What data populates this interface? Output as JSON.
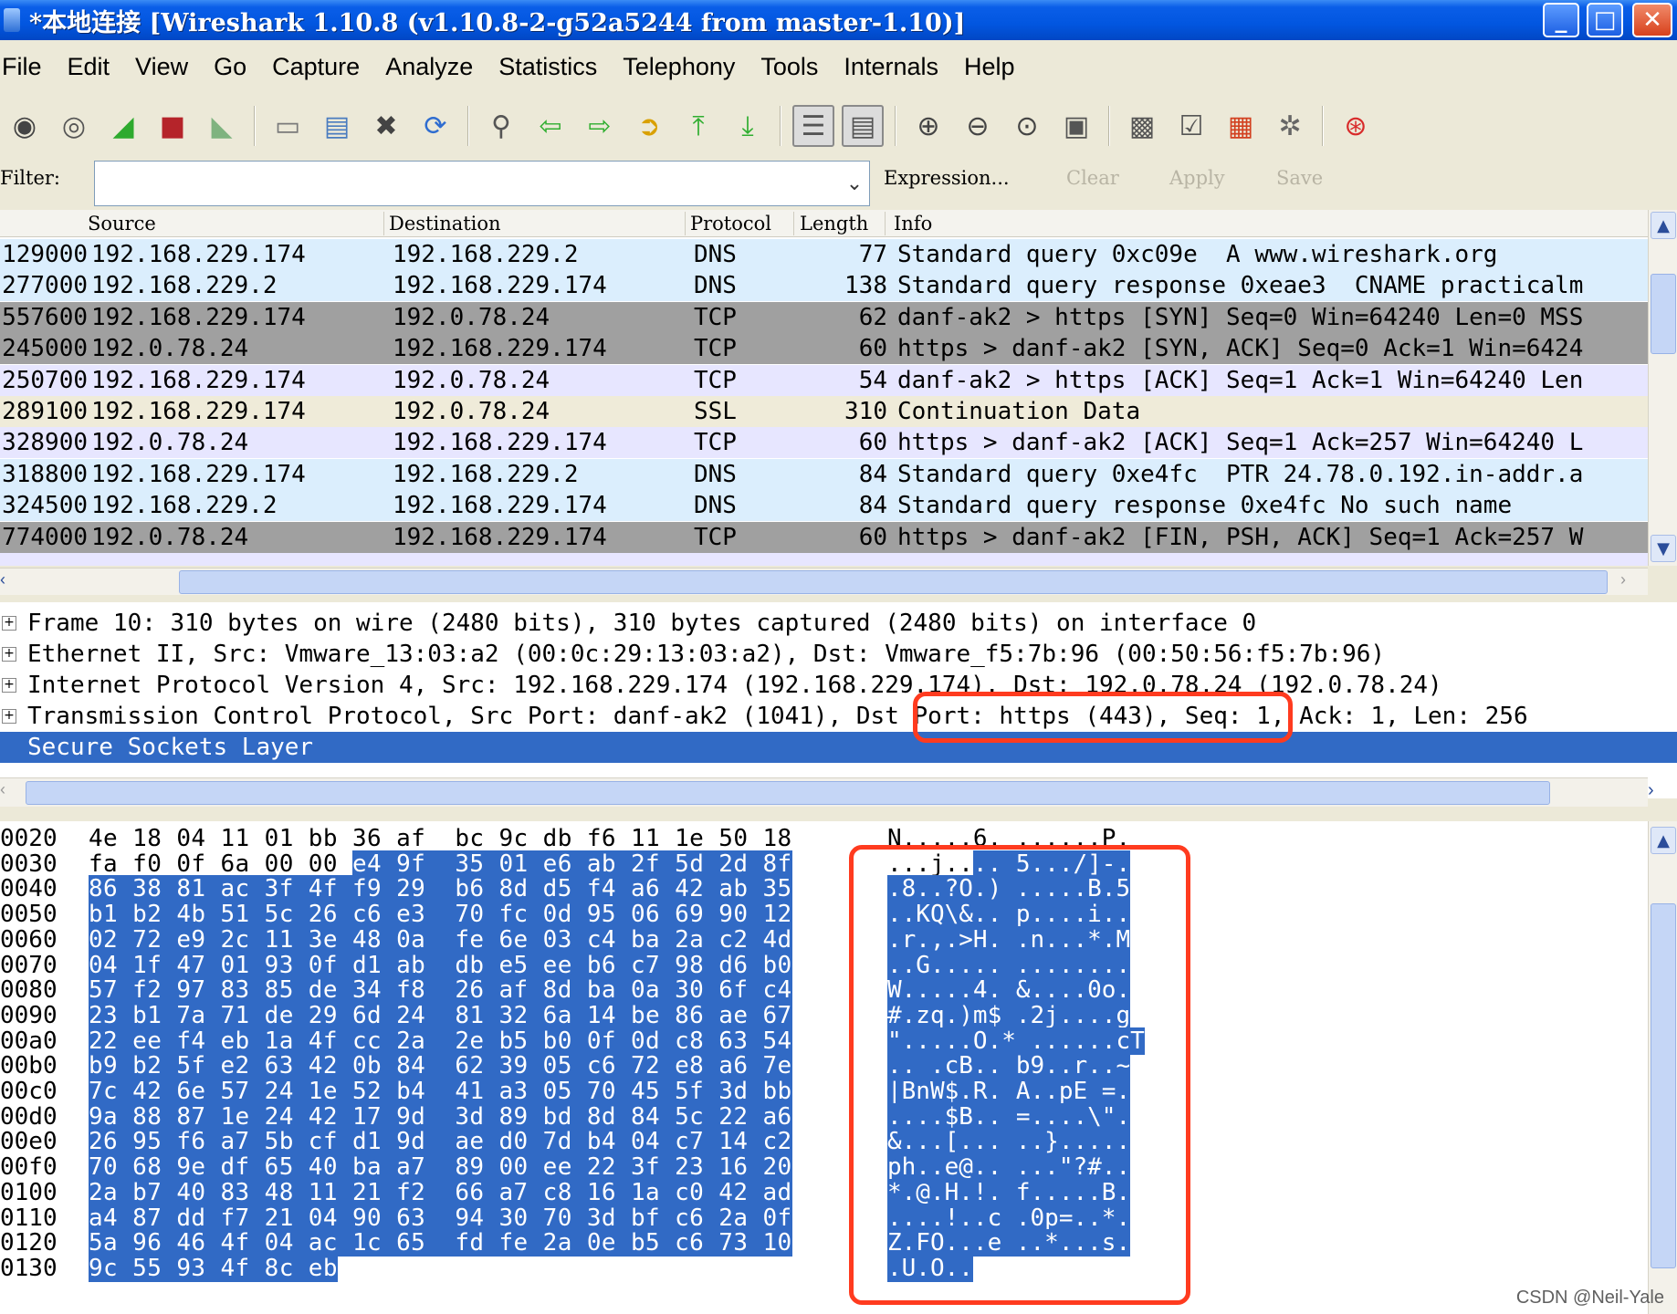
{
  "window": {
    "title": "*本地连接    [Wireshark 1.10.8  (v1.10.8-2-g52a5244 from master-1.10)]",
    "controls": [
      "minimize",
      "maximize",
      "close"
    ]
  },
  "menu": [
    "File",
    "Edit",
    "View",
    "Go",
    "Capture",
    "Analyze",
    "Statistics",
    "Telephony",
    "Tools",
    "Internals",
    "Help"
  ],
  "toolbar": {
    "icons": [
      "interface-list-icon",
      "capture-options-icon",
      "start-capture-icon",
      "stop-capture-icon",
      "restart-capture-icon",
      "open-file-icon",
      "save-file-icon",
      "close-file-icon",
      "reload-icon",
      "find-packet-icon",
      "go-back-icon",
      "go-forward-icon",
      "go-to-packet-icon",
      "go-first-icon",
      "go-last-icon",
      "colorize-icon",
      "autoscroll-icon",
      "zoom-in-icon",
      "zoom-out-icon",
      "normal-size-icon",
      "resize-columns-icon",
      "capture-filters-icon",
      "display-filters-icon",
      "coloring-rules-icon",
      "preferences-icon",
      "help-icon"
    ]
  },
  "filter": {
    "label": "Filter:",
    "value": "",
    "expression": "Expression...",
    "clear": "Clear",
    "apply": "Apply",
    "save": "Save"
  },
  "packet_list": {
    "columns": [
      "Source",
      "Destination",
      "Protocol",
      "Length",
      "Info"
    ],
    "rows": [
      {
        "no": "129000",
        "src": "192.168.229.174",
        "dst": "192.168.229.2",
        "proto": "DNS",
        "len": "77",
        "info": "Standard query 0xc09e  A www.wireshark.org",
        "bg": "#dbeefd"
      },
      {
        "no": "277000",
        "src": "192.168.229.2",
        "dst": "192.168.229.174",
        "proto": "DNS",
        "len": "138",
        "info": "Standard query response 0xeae3  CNAME practicalm",
        "bg": "#dbeefd"
      },
      {
        "no": "557600",
        "src": "192.168.229.174",
        "dst": "192.0.78.24",
        "proto": "TCP",
        "len": "62",
        "info": "danf-ak2 > https [SYN] Seq=0 Win=64240 Len=0 MSS",
        "bg": "#a0a0a0"
      },
      {
        "no": "245000",
        "src": "192.0.78.24",
        "dst": "192.168.229.174",
        "proto": "TCP",
        "len": "60",
        "info": "https > danf-ak2 [SYN, ACK] Seq=0 Ack=1 Win=6424",
        "bg": "#a0a0a0"
      },
      {
        "no": "250700",
        "src": "192.168.229.174",
        "dst": "192.0.78.24",
        "proto": "TCP",
        "len": "54",
        "info": "danf-ak2 > https [ACK] Seq=1 Ack=1 Win=64240 Len",
        "bg": "#e7e6ff"
      },
      {
        "no": "289100",
        "src": "192.168.229.174",
        "dst": "192.0.78.24",
        "proto": "SSL",
        "len": "310",
        "info": "Continuation Data",
        "bg": "#efebd9"
      },
      {
        "no": "328900",
        "src": "192.0.78.24",
        "dst": "192.168.229.174",
        "proto": "TCP",
        "len": "60",
        "info": "https > danf-ak2 [ACK] Seq=1 Ack=257 Win=64240 L",
        "bg": "#e7e6ff"
      },
      {
        "no": "318800",
        "src": "192.168.229.174",
        "dst": "192.168.229.2",
        "proto": "DNS",
        "len": "84",
        "info": "Standard query 0xe4fc  PTR 24.78.0.192.in-addr.a",
        "bg": "#dbeefd"
      },
      {
        "no": "324500",
        "src": "192.168.229.2",
        "dst": "192.168.229.174",
        "proto": "DNS",
        "len": "84",
        "info": "Standard query response 0xe4fc No such name",
        "bg": "#dbeefd"
      },
      {
        "no": "774000",
        "src": "192.0.78.24",
        "dst": "192.168.229.174",
        "proto": "TCP",
        "len": "60",
        "info": "https > danf-ak2 [FIN, PSH, ACK] Seq=1 Ack=257 W",
        "bg": "#a0a0a0"
      }
    ]
  },
  "details": {
    "rows": [
      {
        "text": "Frame 10: 310 bytes on wire (2480 bits), 310 bytes captured (2480 bits) on interface 0",
        "expandable": true,
        "selected": false
      },
      {
        "text": "Ethernet II, Src: Vmware_13:03:a2 (00:0c:29:13:03:a2), Dst: Vmware_f5:7b:96 (00:50:56:f5:7b:96)",
        "expandable": true,
        "selected": false
      },
      {
        "text": "Internet Protocol Version 4, Src: 192.168.229.174 (192.168.229.174), Dst: 192.0.78.24 (192.0.78.24)",
        "expandable": true,
        "selected": false
      },
      {
        "text": "Transmission Control Protocol, Src Port: danf-ak2 (1041), Dst Port: https (443), Seq: 1, Ack: 1, Len: 256",
        "expandable": true,
        "selected": false
      },
      {
        "text": "Secure Sockets Layer",
        "expandable": false,
        "selected": true
      }
    ]
  },
  "hex": {
    "rows": [
      {
        "off": "0020",
        "pre": "4e 18 04 11 01 bb 36 af  bc 9c db f6 11 1e 50 18",
        "sel": "",
        "apre": "N.....6. ......P.",
        "asel": ""
      },
      {
        "off": "0030",
        "pre": "fa f0 0f 6a 00 00 ",
        "sel": "e4 9f  35 01 e6 ab 2f 5d 2d 8f",
        "apre": "...j..",
        "asel": ".. 5.../]-."
      },
      {
        "off": "0040",
        "pre": "",
        "sel": "86 38 81 ac 3f 4f f9 29  b6 8d d5 f4 a6 42 ab 35",
        "apre": "",
        "asel": ".8..?O.) .....B.5"
      },
      {
        "off": "0050",
        "pre": "",
        "sel": "b1 b2 4b 51 5c 26 c6 e3  70 fc 0d 95 06 69 90 12",
        "apre": "",
        "asel": "..KQ\\&.. p....i.."
      },
      {
        "off": "0060",
        "pre": "",
        "sel": "02 72 e9 2c 11 3e 48 0a  fe 6e 03 c4 ba 2a c2 4d",
        "apre": "",
        "asel": ".r.,.>H. .n...*.M"
      },
      {
        "off": "0070",
        "pre": "",
        "sel": "04 1f 47 01 93 0f d1 ab  db e5 ee b6 c7 98 d6 b0",
        "apre": "",
        "asel": "..G..... ........"
      },
      {
        "off": "0080",
        "pre": "",
        "sel": "57 f2 97 83 85 de 34 f8  26 af 8d ba 0a 30 6f c4",
        "apre": "",
        "asel": "W.....4. &....0o."
      },
      {
        "off": "0090",
        "pre": "",
        "sel": "23 b1 7a 71 de 29 6d 24  81 32 6a 14 be 86 ae 67",
        "apre": "",
        "asel": "#.zq.)m$ .2j....g"
      },
      {
        "off": "00a0",
        "pre": "",
        "sel": "22 ee f4 eb 1a 4f cc 2a  2e b5 b0 0f 0d c8 63 54",
        "apre": "",
        "asel": "\".....O.* ......cT"
      },
      {
        "off": "00b0",
        "pre": "",
        "sel": "b9 b2 5f e2 63 42 0b 84  62 39 05 c6 72 e8 a6 7e",
        "apre": "",
        "asel": ".._.cB.. b9..r..~"
      },
      {
        "off": "00c0",
        "pre": "",
        "sel": "7c 42 6e 57 24 1e 52 b4  41 a3 05 70 45 5f 3d bb",
        "apre": "",
        "asel": "|BnW$.R. A..pE_=."
      },
      {
        "off": "00d0",
        "pre": "",
        "sel": "9a 88 87 1e 24 42 17 9d  3d 89 bd 8d 84 5c 22 a6",
        "apre": "",
        "asel": "....$B.. =....\\\"."
      },
      {
        "off": "00e0",
        "pre": "",
        "sel": "26 95 f6 a7 5b cf d1 9d  ae d0 7d b4 04 c7 14 c2",
        "apre": "",
        "asel": "&...[... ..}....."
      },
      {
        "off": "00f0",
        "pre": "",
        "sel": "70 68 9e df 65 40 ba a7  89 00 ee 22 3f 23 16 20",
        "apre": "",
        "asel": "ph..e@.. ...\"?#.."
      },
      {
        "off": "0100",
        "pre": "",
        "sel": "2a b7 40 83 48 11 21 f2  66 a7 c8 16 1a c0 42 ad",
        "apre": "",
        "asel": "*.@.H.!. f.....B."
      },
      {
        "off": "0110",
        "pre": "",
        "sel": "a4 87 dd f7 21 04 90 63  94 30 70 3d bf c6 2a 0f",
        "apre": "",
        "asel": "....!..c .0p=..*."
      },
      {
        "off": "0120",
        "pre": "",
        "sel": "5a 96 46 4f 04 ac 1c 65  fd fe 2a 0e b5 c6 73 10",
        "apre": "",
        "asel": "Z.FO...e ..*...s."
      },
      {
        "off": "0130",
        "pre": "",
        "sel": "9c 55 93 4f 8c eb",
        "apre": "",
        "asel": ".U.O.."
      }
    ]
  },
  "watermark": "CSDN @Neil-Yale",
  "colors": {
    "selection": "#316ac5",
    "highlight_box": "#ff3b1f",
    "titlebar": "#0256e0"
  }
}
